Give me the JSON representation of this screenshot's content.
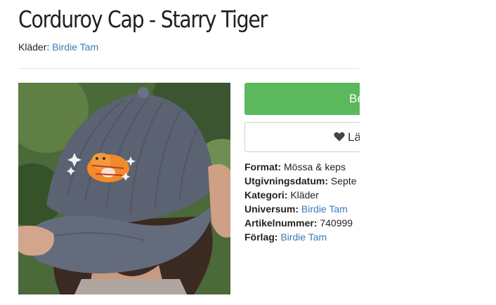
{
  "product": {
    "title": "Corduroy Cap - Starry Tiger",
    "category_label": "Kläder:",
    "brand_link": "Birdie Tam"
  },
  "actions": {
    "buy_label": "Be",
    "wishlist_label": "Lä"
  },
  "specs": [
    {
      "label": "Format:",
      "value": "Mössa & keps",
      "link": false
    },
    {
      "label": "Utgivningsdatum:",
      "value": "Septe",
      "link": false
    },
    {
      "label": "Kategori:",
      "value": "Kläder",
      "link": false
    },
    {
      "label": "Universum:",
      "value": "Birdie Tam",
      "link": true
    },
    {
      "label": "Artikelnummer:",
      "value": "740999",
      "link": false
    },
    {
      "label": "Förlag:",
      "value": "Birdie Tam",
      "link": true
    }
  ],
  "colors": {
    "buy_button": "#5cb85c",
    "link": "#3a7ab7",
    "cap": "#5b6272"
  },
  "icons": {
    "wishlist": "heart-icon"
  }
}
